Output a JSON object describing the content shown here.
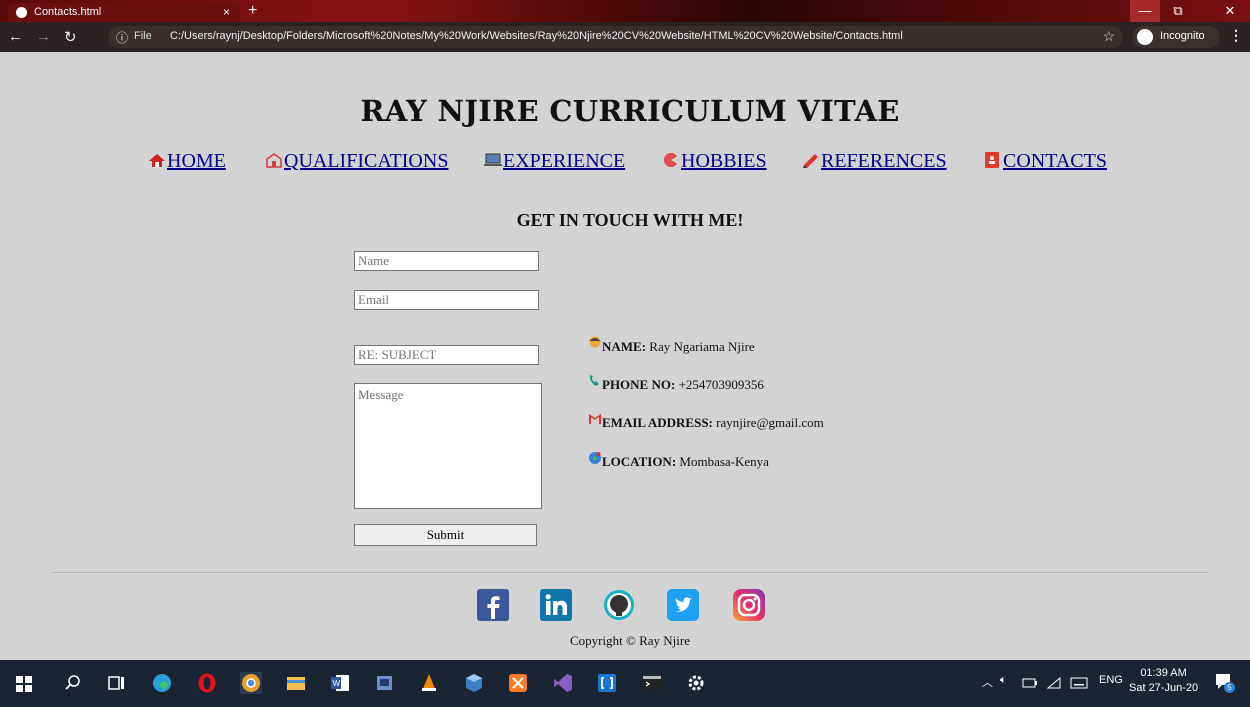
{
  "browser": {
    "tab_title": "Contacts.html",
    "tab_close": "×",
    "new_tab": "+",
    "file_label": "File",
    "url": "C:/Users/raynj/Desktop/Folders/Microsoft%20Notes/My%20Work/Websites/Ray%20Njire%20CV%20Website/HTML%20CV%20Website/Contacts.html",
    "incognito_label": "Incognito",
    "win_min": "—",
    "win_max": "⧉",
    "win_close": "✕"
  },
  "page": {
    "heading": "RAY NJIRE CURRICULUM VITAE",
    "nav": [
      {
        "label": "HOME",
        "icon": "home-icon"
      },
      {
        "label": "QUALIFICATIONS",
        "icon": "qualifications-icon"
      },
      {
        "label": "EXPERIENCE",
        "icon": "laptop-icon"
      },
      {
        "label": "HOBBIES",
        "icon": "hobbies-icon"
      },
      {
        "label": "REFERENCES",
        "icon": "pencil-icon"
      },
      {
        "label": "CONTACTS",
        "icon": "contact-book-icon"
      }
    ],
    "section_title": "GET IN TOUCH WITH ME!",
    "form": {
      "name_placeholder": "Name",
      "email_placeholder": "Email",
      "subject_placeholder": "RE: SUBJECT",
      "message_placeholder": "Message",
      "submit_label": "Submit"
    },
    "contact_info": [
      {
        "label": "NAME:",
        "value": "Ray Ngariama Njire",
        "icon": "person-icon"
      },
      {
        "label": "PHONE NO:",
        "value": "+254703909356",
        "icon": "phone-icon"
      },
      {
        "label": "EMAIL ADDRESS:",
        "value": "raynjire@gmail.com",
        "icon": "gmail-icon"
      },
      {
        "label": "LOCATION:",
        "value": "Mombasa-Kenya",
        "icon": "globe-icon"
      }
    ],
    "social": [
      "facebook-icon",
      "linkedin-icon",
      "github-icon",
      "twitter-icon",
      "instagram-icon"
    ],
    "copyright": "Copyright © Ray Njire"
  },
  "taskbar": {
    "lang": "ENG",
    "time": "01:39 AM",
    "date": "Sat 27-Jun-20",
    "notifications": "5"
  },
  "colors": {
    "page_bg": "#d3d3d3",
    "link": "#00008b",
    "titlebar": "#6b0e0e",
    "taskbar": "#1a2433"
  }
}
